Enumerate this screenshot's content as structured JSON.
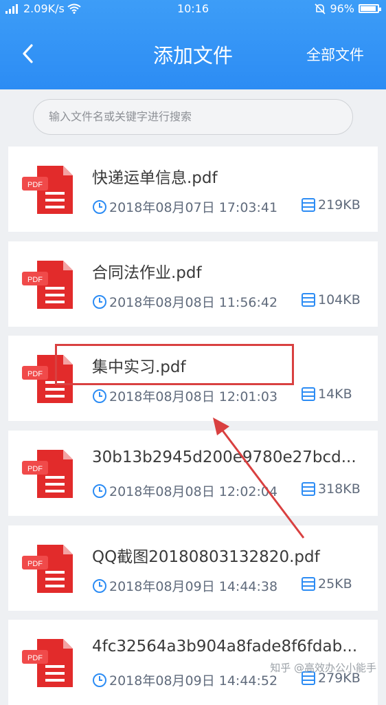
{
  "status_bar": {
    "network_speed": "2.09K/s",
    "time": "10:16",
    "battery": "96%"
  },
  "header": {
    "title": "添加文件",
    "right_action": "全部文件"
  },
  "search": {
    "placeholder": "输入文件名或关键字进行搜索"
  },
  "files": [
    {
      "icon_label": "PDF",
      "name": "快递运单信息.pdf",
      "date": "2018年08月07日 17:03:41",
      "size": "219KB"
    },
    {
      "icon_label": "PDF",
      "name": "合同法作业.pdf",
      "date": "2018年08月08日 11:56:42",
      "size": "104KB"
    },
    {
      "icon_label": "PDF",
      "name": "集中实习.pdf",
      "date": "2018年08月08日 12:01:03",
      "size": "14KB"
    },
    {
      "icon_label": "PDF",
      "name": "30b13b2945d200e9780e27bcd...",
      "date": "2018年08月08日 12:02:04",
      "size": "318KB"
    },
    {
      "icon_label": "PDF",
      "name": "QQ截图20180803132820.pdf",
      "date": "2018年08月09日 14:44:38",
      "size": "25KB"
    },
    {
      "icon_label": "PDF",
      "name": "4fc32564a3b904a8fade8f6fdab...",
      "date": "2018年08月09日 14:44:52",
      "size": "279KB"
    }
  ],
  "watermark": "知乎 @高效办公小能手",
  "colors": {
    "header_blue": "#2c8cf4",
    "pdf_red": "#e22b2b",
    "annotation_red": "#d94040"
  }
}
